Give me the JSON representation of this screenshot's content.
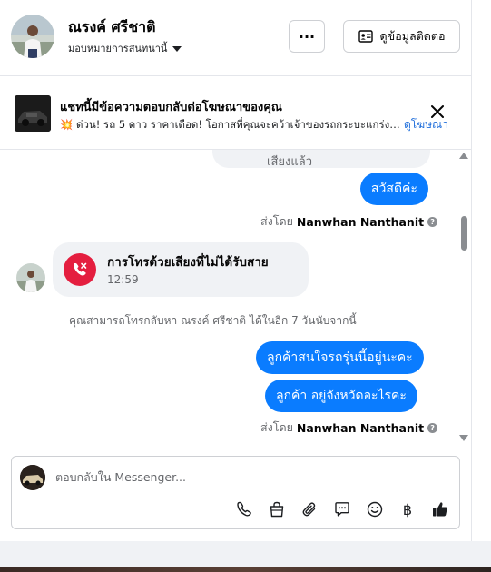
{
  "header": {
    "name": "ณรงค์ ศรีชาติ",
    "assignee": "มอบหมายการสนทนานี้",
    "more_label": "···",
    "contact_label": "ดูข้อมูลติดต่อ"
  },
  "ad_notice": {
    "title": "แชทนี้มีข้อความตอบกลับต่อโฆษณาของคุณ",
    "text": "💥 ด่วน! รถ 5 ดาว ราคาเดือด! โอกาสที่คุณจะคว้าเจ้าของรถกระบะแกร่ง Toy...",
    "link": "ดูโฆษณา"
  },
  "messages": {
    "partial_top": "เสียงแล้ว",
    "hello": "สวัสดีค่ะ",
    "sent_by_prefix": "ส่งโดย",
    "sent_by_name": "Nanwhan Nanthanit",
    "missed_call_title": "การโทรด้วยเสียงที่ไม่ได้รับสาย",
    "missed_call_time": "12:59",
    "callback_note": "คุณสามารถโทรกลับหา ณรงค์ ศรีชาติ ได้ในอีก 7 วันนับจากนี้",
    "msg_interest": "ลูกค้าสนใจรถรุ่นนี้อยู่นะคะ",
    "msg_province": "ลูกค้า  อยู่จังหวัดอะไรคะ"
  },
  "composer": {
    "placeholder": "ตอบกลับใน Messenger...",
    "baht_symbol": "฿"
  },
  "colors": {
    "blue_bubble": "#0a7cff",
    "missed_call": "#e41e3f",
    "link": "#216fdb"
  }
}
